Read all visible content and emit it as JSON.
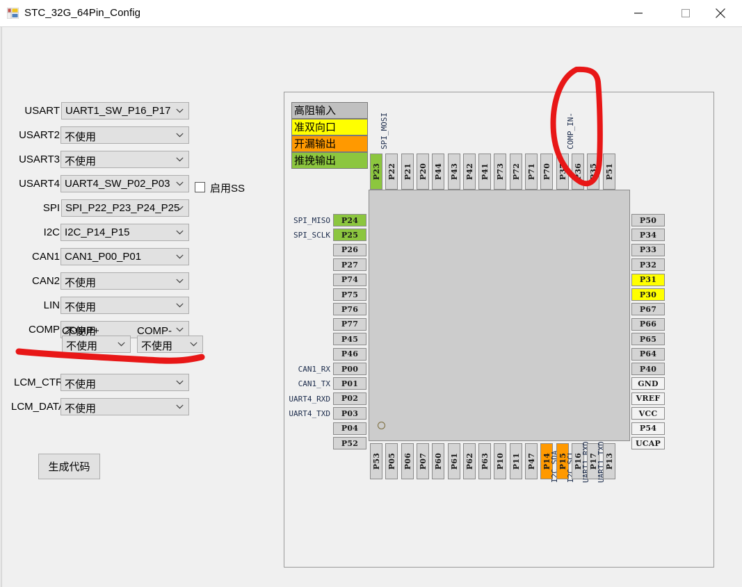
{
  "window": {
    "title": "STC_32G_64Pin_Config",
    "icon": "app-icon",
    "minimize": "—",
    "maximize": "□",
    "close": "✕"
  },
  "form": {
    "rows": [
      {
        "label": "USART",
        "value": "UART1_SW_P16_P17",
        "wide": false
      },
      {
        "label": "USART2",
        "value": "不使用",
        "wide": true
      },
      {
        "label": "USART3",
        "value": "不使用",
        "wide": true
      },
      {
        "label": "USART4",
        "value": "UART4_SW_P02_P03",
        "wide": true
      },
      {
        "label": "SPI",
        "value": "SPI_P22_P23_P24_P25",
        "wide": false
      },
      {
        "label": "I2C",
        "value": "I2C_P14_P15",
        "wide": true
      },
      {
        "label": "CAN1",
        "value": "CAN1_P00_P01",
        "wide": true
      },
      {
        "label": "CAN2",
        "value": "不使用",
        "wide": true
      },
      {
        "label": "LIN",
        "value": "不使用",
        "wide": true
      },
      {
        "label": "COMP",
        "value": "不使用",
        "wide": true
      }
    ],
    "comp_plus": {
      "label": "COMP+",
      "value": "不使用"
    },
    "comp_minus": {
      "label": "COMP-",
      "value": "不使用"
    },
    "lcm_ctrl": {
      "label": "LCM_CTRL",
      "value": "不使用"
    },
    "lcm_data": {
      "label": "LCM_DATA",
      "value": "不使用"
    },
    "enable_ss": {
      "label": "启用SS",
      "checked": false
    },
    "generate_button": "生成代码"
  },
  "legend": [
    {
      "label": "高阻输入",
      "color": "#c0c0c0"
    },
    {
      "label": "准双向口",
      "color": "#ffff00"
    },
    {
      "label": "开漏输出",
      "color": "#ff9900"
    },
    {
      "label": "推挽输出",
      "color": "#8cc63f"
    }
  ],
  "colors": {
    "high_impedance": "#c0c0c0",
    "quasi_bidirectional": "#ffff00",
    "open_drain": "#ff9900",
    "push_pull": "#8cc63f",
    "default_pin": "#d4d4d4",
    "power_pin": "#f3f3f3",
    "annotation": "#e81717",
    "chip_body": "#cccccc"
  },
  "chip": {
    "top_pins": [
      {
        "name": "P23",
        "color": "#8cc63f",
        "signal": "SPI_MOSI"
      },
      {
        "name": "P22",
        "color": "#d4d4d4",
        "signal": ""
      },
      {
        "name": "P21",
        "color": "#d4d4d4",
        "signal": ""
      },
      {
        "name": "P20",
        "color": "#d4d4d4",
        "signal": ""
      },
      {
        "name": "P44",
        "color": "#d4d4d4",
        "signal": ""
      },
      {
        "name": "P43",
        "color": "#d4d4d4",
        "signal": ""
      },
      {
        "name": "P42",
        "color": "#d4d4d4",
        "signal": ""
      },
      {
        "name": "P41",
        "color": "#d4d4d4",
        "signal": ""
      },
      {
        "name": "P73",
        "color": "#d4d4d4",
        "signal": ""
      },
      {
        "name": "P72",
        "color": "#d4d4d4",
        "signal": ""
      },
      {
        "name": "P71",
        "color": "#d4d4d4",
        "signal": ""
      },
      {
        "name": "P70",
        "color": "#d4d4d4",
        "signal": ""
      },
      {
        "name": "P37",
        "color": "#d4d4d4",
        "signal": "COMP_IN-"
      },
      {
        "name": "P36",
        "color": "#d4d4d4",
        "signal": ""
      },
      {
        "name": "P35",
        "color": "#d4d4d4",
        "signal": ""
      },
      {
        "name": "P51",
        "color": "#d4d4d4",
        "signal": ""
      }
    ],
    "left_pins": [
      {
        "name": "P24",
        "color": "#8cc63f",
        "signal": "SPI_MISO"
      },
      {
        "name": "P25",
        "color": "#8cc63f",
        "signal": "SPI_SCLK"
      },
      {
        "name": "P26",
        "color": "#d4d4d4",
        "signal": ""
      },
      {
        "name": "P27",
        "color": "#d4d4d4",
        "signal": ""
      },
      {
        "name": "P74",
        "color": "#d4d4d4",
        "signal": ""
      },
      {
        "name": "P75",
        "color": "#d4d4d4",
        "signal": ""
      },
      {
        "name": "P76",
        "color": "#d4d4d4",
        "signal": ""
      },
      {
        "name": "P77",
        "color": "#d4d4d4",
        "signal": ""
      },
      {
        "name": "P45",
        "color": "#d4d4d4",
        "signal": ""
      },
      {
        "name": "P46",
        "color": "#d4d4d4",
        "signal": ""
      },
      {
        "name": "P00",
        "color": "#d4d4d4",
        "signal": "CAN1_RX"
      },
      {
        "name": "P01",
        "color": "#d4d4d4",
        "signal": "CAN1_TX"
      },
      {
        "name": "P02",
        "color": "#d4d4d4",
        "signal": "UART4_RXD"
      },
      {
        "name": "P03",
        "color": "#d4d4d4",
        "signal": "UART4_TXD"
      },
      {
        "name": "P04",
        "color": "#d4d4d4",
        "signal": ""
      },
      {
        "name": "P52",
        "color": "#d4d4d4",
        "signal": ""
      }
    ],
    "right_pins": [
      {
        "name": "P50",
        "color": "#d4d4d4",
        "signal": ""
      },
      {
        "name": "P34",
        "color": "#d4d4d4",
        "signal": ""
      },
      {
        "name": "P33",
        "color": "#d4d4d4",
        "signal": ""
      },
      {
        "name": "P32",
        "color": "#d4d4d4",
        "signal": ""
      },
      {
        "name": "P31",
        "color": "#ffff00",
        "signal": ""
      },
      {
        "name": "P30",
        "color": "#ffff00",
        "signal": ""
      },
      {
        "name": "P67",
        "color": "#d4d4d4",
        "signal": ""
      },
      {
        "name": "P66",
        "color": "#d4d4d4",
        "signal": ""
      },
      {
        "name": "P65",
        "color": "#d4d4d4",
        "signal": ""
      },
      {
        "name": "P64",
        "color": "#d4d4d4",
        "signal": ""
      },
      {
        "name": "P40",
        "color": "#d4d4d4",
        "signal": ""
      },
      {
        "name": "GND",
        "color": "#f3f3f3",
        "signal": ""
      },
      {
        "name": "VREF",
        "color": "#f3f3f3",
        "signal": ""
      },
      {
        "name": "VCC",
        "color": "#f3f3f3",
        "signal": ""
      },
      {
        "name": "P54",
        "color": "#f3f3f3",
        "signal": ""
      },
      {
        "name": "UCAP",
        "color": "#f3f3f3",
        "signal": ""
      }
    ],
    "bottom_pins": [
      {
        "name": "P53",
        "color": "#d4d4d4",
        "signal": ""
      },
      {
        "name": "P05",
        "color": "#d4d4d4",
        "signal": ""
      },
      {
        "name": "P06",
        "color": "#d4d4d4",
        "signal": ""
      },
      {
        "name": "P07",
        "color": "#d4d4d4",
        "signal": ""
      },
      {
        "name": "P60",
        "color": "#d4d4d4",
        "signal": ""
      },
      {
        "name": "P61",
        "color": "#d4d4d4",
        "signal": ""
      },
      {
        "name": "P62",
        "color": "#d4d4d4",
        "signal": ""
      },
      {
        "name": "P63",
        "color": "#d4d4d4",
        "signal": ""
      },
      {
        "name": "P10",
        "color": "#d4d4d4",
        "signal": ""
      },
      {
        "name": "P11",
        "color": "#d4d4d4",
        "signal": ""
      },
      {
        "name": "P47",
        "color": "#d4d4d4",
        "signal": ""
      },
      {
        "name": "P14",
        "color": "#ff9900",
        "signal": "I2C_SDA"
      },
      {
        "name": "P15",
        "color": "#ff9900",
        "signal": "I2C_SCL"
      },
      {
        "name": "P16",
        "color": "#d4d4d4",
        "signal": "UART1_RXD"
      },
      {
        "name": "P17",
        "color": "#d4d4d4",
        "signal": "UART1_TXD"
      },
      {
        "name": "P13",
        "color": "#d4d4d4",
        "signal": ""
      }
    ]
  },
  "annotations": [
    {
      "name": "comp-in-circle",
      "shape": "u-loop"
    },
    {
      "name": "comp-row-underline",
      "shape": "wavy-line"
    }
  ]
}
